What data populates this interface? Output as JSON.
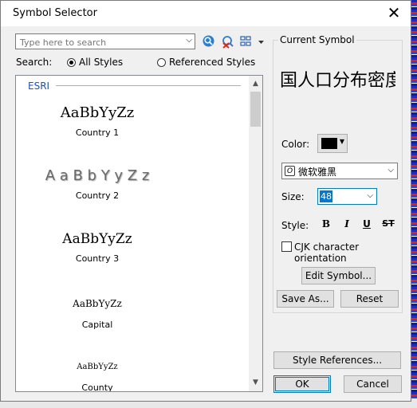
{
  "window": {
    "title": "Symbol Selector",
    "close_glyph": "✕"
  },
  "search": {
    "placeholder": "Type here to search",
    "label": "Search:",
    "options": [
      {
        "label": "All Styles",
        "selected": true
      },
      {
        "label": "Referenced Styles",
        "selected": false
      }
    ]
  },
  "toolbar": {
    "icons": [
      "search-icon",
      "clear-search-icon",
      "view-options-icon"
    ]
  },
  "symbol_list": {
    "group": "ESRI",
    "items": [
      {
        "sample": "AaBbYyZz",
        "name": "Country 1"
      },
      {
        "sample": "A a B b Y y Z z",
        "name": "Country 2"
      },
      {
        "sample": "AaBbYyZz",
        "name": "Country 3"
      },
      {
        "sample": "AaBbYyZz",
        "name": "Capital"
      },
      {
        "sample": "AaBbYyZz",
        "name": "County"
      }
    ]
  },
  "current_symbol": {
    "title": "Current Symbol",
    "preview_text": "国人口分布密度",
    "color_label": "Color:",
    "color": "#000000",
    "font": "微软雅黑",
    "size_label": "Size:",
    "size": "48",
    "style_label": "Style:",
    "style_buttons": [
      "B",
      "I",
      "U",
      "ST"
    ],
    "cjk_label": "CJK character orientation",
    "cjk_checked": false,
    "edit_symbol": "Edit Symbol...",
    "save_as": "Save As...",
    "reset": "Reset"
  },
  "footer": {
    "style_references": "Style References...",
    "ok": "OK",
    "cancel": "Cancel"
  },
  "colors": {
    "accent": "#0078d7",
    "group_label": "#1a4fc5"
  }
}
